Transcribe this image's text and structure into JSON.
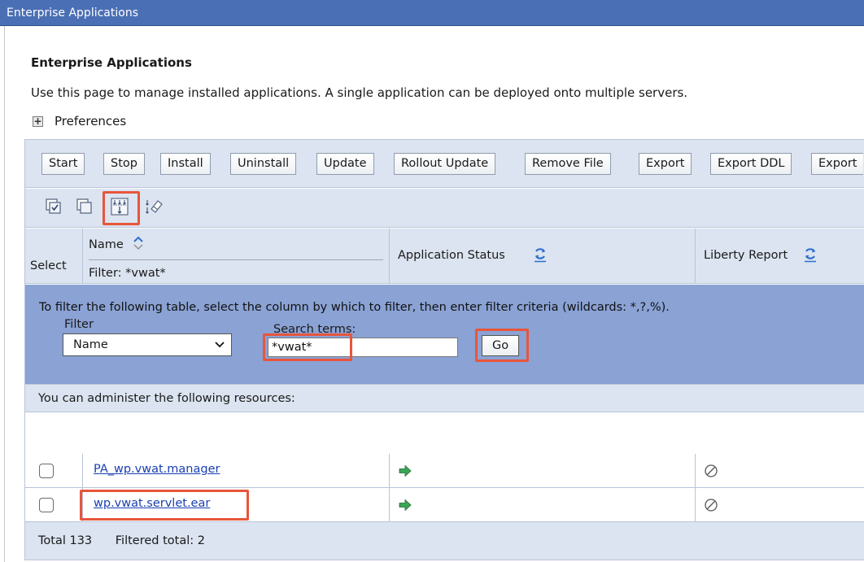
{
  "window": {
    "title": "Enterprise Applications"
  },
  "page": {
    "heading": "Enterprise Applications",
    "description": "Use this page to manage installed applications. A single application can be deployed onto multiple servers.",
    "preferences_label": "Preferences"
  },
  "toolbar": {
    "buttons": [
      "Start",
      "Stop",
      "Install",
      "Uninstall",
      "Update",
      "Rollout Update",
      "Remove File",
      "Export",
      "Export DDL",
      "Export"
    ]
  },
  "icon_toolbar": {
    "icons": [
      "select-all-icon",
      "deselect-all-icon",
      "show-filter-icon",
      "clear-filter-icon"
    ],
    "highlighted": "show-filter-icon"
  },
  "table": {
    "columns": {
      "select": "Select",
      "name": "Name",
      "name_filter": "Filter: *vwat*",
      "status": "Application Status",
      "liberty": "Liberty Report"
    },
    "filter": {
      "instruction": "To filter the following table, select the column by which to filter, then enter filter criteria (wildcards: *,?,%).",
      "filter_label": "Filter",
      "filter_value": "Name",
      "search_label": "Search terms:",
      "search_value": "*vwat*",
      "go_label": "Go"
    },
    "resources_label": "You can administer the following resources:",
    "rows": [
      {
        "name": "PA_wp.vwat.manager",
        "status": "started",
        "liberty": "not-applicable",
        "highlighted": false
      },
      {
        "name": "wp.vwat.servlet.ear",
        "status": "started",
        "liberty": "not-applicable",
        "highlighted": true
      }
    ],
    "footer": {
      "total": "Total 133",
      "filtered": "Filtered total: 2"
    }
  },
  "colors": {
    "title_bar": "#4a6fb5",
    "header_bg": "#dbe4f0",
    "filter_bg": "#8aa2d4",
    "highlight": "#e8553b",
    "link": "#1a3fb0",
    "status_green": "#3aa655"
  }
}
